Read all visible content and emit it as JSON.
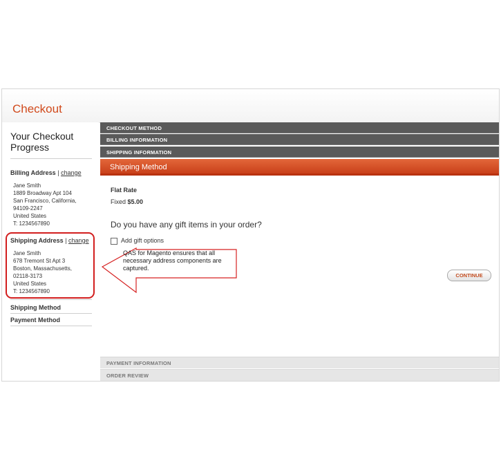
{
  "page": {
    "title": "Checkout"
  },
  "sidebar": {
    "title": "Your Checkout Progress",
    "billing": {
      "label": "Billing Address",
      "separator": "|",
      "change": "change",
      "lines": [
        "Jane Smith",
        "1889 Broadway Apt 104",
        "San Francisco, California,",
        "94109-2247",
        "United States",
        "T: 1234567890"
      ]
    },
    "shipping": {
      "label": "Shipping Address",
      "separator": "|",
      "change": "change",
      "lines": [
        "Jane Smith",
        "678 Tremont St Apt 3",
        "Boston, Massachusetts,",
        "02118-3173",
        "United States",
        "T: 1234567890"
      ]
    },
    "shipping_method_label": "Shipping Method",
    "payment_method_label": "Payment Method"
  },
  "steps": {
    "checkout_method": "CHECKOUT METHOD",
    "billing_information": "BILLING INFORMATION",
    "shipping_information": "SHIPPING INFORMATION",
    "shipping_method": "Shipping Method",
    "payment_information": "PAYMENT INFORMATION",
    "order_review": "ORDER REVIEW"
  },
  "shipping_method": {
    "rate_name": "Flat Rate",
    "rate_text": "Fixed",
    "rate_price": "$5.00",
    "gift_question": "Do you have any gift items in your order?",
    "gift_option_label": "Add gift options",
    "continue_label": "CONTINUE"
  },
  "annotation": {
    "text": "QAS for Magento ensures that all necessary address components are captured."
  },
  "colors": {
    "accent": "#d14a1c",
    "active_step": "#d5501f",
    "step_bar": "#5a5a5a",
    "annotation": "#d21d1d"
  }
}
